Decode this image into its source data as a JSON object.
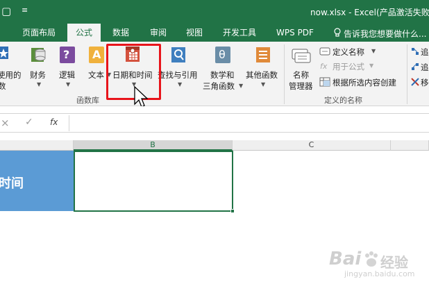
{
  "titlebar": {
    "qat_glyph": "▢",
    "qat_caret": "≡",
    "title": "now.xlsx - Excel(产品激活失败)"
  },
  "tabs": [
    {
      "label": "页面布局"
    },
    {
      "label": "公式"
    },
    {
      "label": "数据"
    },
    {
      "label": "审阅"
    },
    {
      "label": "视图"
    },
    {
      "label": "开发工具"
    },
    {
      "label": "WPS PDF"
    }
  ],
  "tell_me": {
    "icon": "lightbulb-icon",
    "text": "告诉我您想要做什么..."
  },
  "ribbon": {
    "function_library": {
      "recently_used": {
        "line1": "使用的",
        "line2": "数"
      },
      "financial": "财务",
      "logical": "逻辑",
      "text": "文本",
      "date_time": "日期和时间",
      "lookup": "查找与引用",
      "math": {
        "line1": "数学和",
        "line2": "三角函数"
      },
      "more": "其他函数",
      "group_label": "函数库",
      "logical_glyph": "?",
      "text_glyph": "A",
      "math_glyph": "θ"
    },
    "defined_names": {
      "name_manager": {
        "line1": "名称",
        "line2": "管理器"
      },
      "define_name": "定义名称",
      "use_in_formula": "用于公式",
      "create_from_selection": "根据所选内容创建",
      "group_label": "定义的名称"
    },
    "auditing_partial": {
      "item1": "追",
      "item2": "追",
      "item3": "移"
    }
  },
  "formula_bar": {
    "cancel": "×",
    "enter": "✓",
    "fx": "fx",
    "value": ""
  },
  "columns": [
    {
      "label": "B"
    },
    {
      "label": "C"
    }
  ],
  "cells": {
    "a_cell_text": "时间",
    "b_cell_value": ""
  },
  "watermark": {
    "brand": "Bai",
    "brand2": "经验",
    "url": "jingyan.baidu.com"
  },
  "colors": {
    "excel_green": "#217346",
    "highlight_red": "#e8141b",
    "header_blue": "#5b9bd5"
  }
}
